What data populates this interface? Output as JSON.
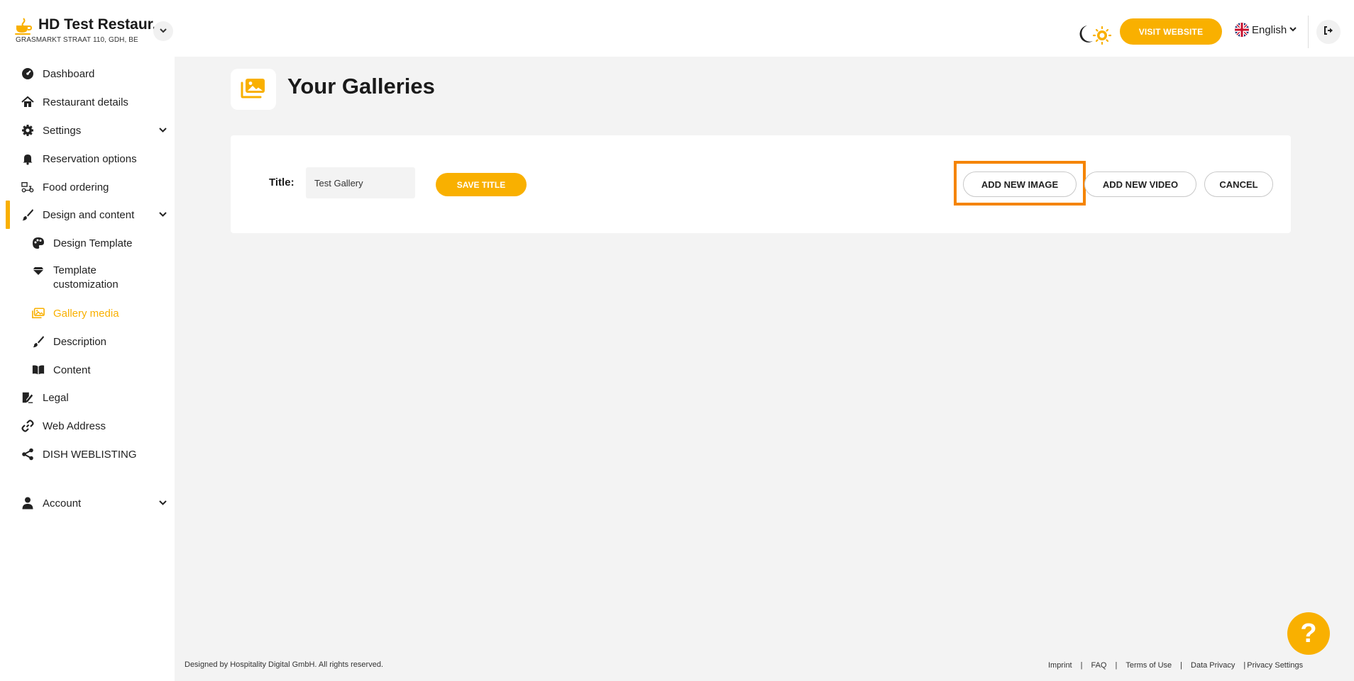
{
  "header": {
    "restaurant_name": "HD Test Restaur...",
    "address": "GRASMARKT STRAAT 110, GDH, BE",
    "visit_website": "VISIT WEBSITE",
    "language": "English"
  },
  "sidebar": {
    "items": [
      {
        "label": "Dashboard"
      },
      {
        "label": "Restaurant details"
      },
      {
        "label": "Settings"
      },
      {
        "label": "Reservation options"
      },
      {
        "label": "Food ordering"
      },
      {
        "label": "Design and content"
      },
      {
        "label": "Design Template"
      },
      {
        "label": "Template customization"
      },
      {
        "label": "Gallery media"
      },
      {
        "label": "Description"
      },
      {
        "label": "Content"
      },
      {
        "label": "Legal"
      },
      {
        "label": "Web Address"
      },
      {
        "label": "DISH WEBLISTING"
      },
      {
        "label": "Account"
      }
    ]
  },
  "main": {
    "title": "Your Galleries",
    "form": {
      "title_label": "Title:",
      "title_value": "Test Gallery",
      "save_label": "SAVE TITLE",
      "add_image_label": "ADD NEW IMAGE",
      "add_video_label": "ADD NEW VIDEO",
      "cancel_label": "CANCEL"
    }
  },
  "footer": {
    "copyright": "Designed by Hospitality Digital GmbH. All rights reserved.",
    "links": [
      "Imprint",
      "FAQ",
      "Terms of Use",
      "Data Privacy",
      "Privacy Settings"
    ]
  },
  "colors": {
    "accent": "#f9b000",
    "highlight": "#f58400",
    "main_bg": "#f3f3f3"
  }
}
